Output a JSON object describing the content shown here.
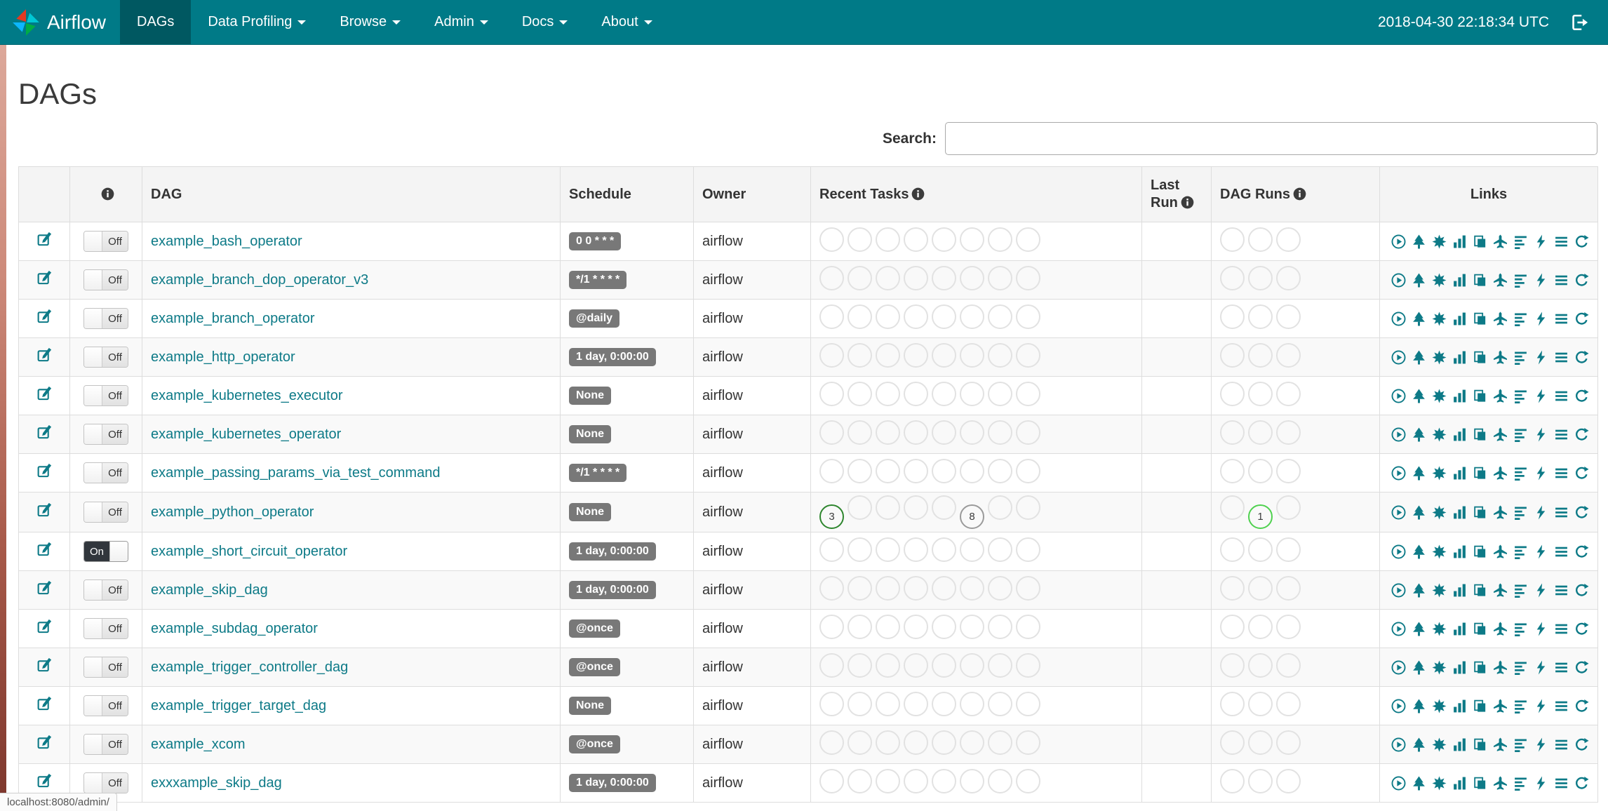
{
  "navbar": {
    "brand": "Airflow",
    "items": [
      {
        "label": "DAGs",
        "active": true,
        "dropdown": false
      },
      {
        "label": "Data Profiling",
        "active": false,
        "dropdown": true
      },
      {
        "label": "Browse",
        "active": false,
        "dropdown": true
      },
      {
        "label": "Admin",
        "active": false,
        "dropdown": true
      },
      {
        "label": "Docs",
        "active": false,
        "dropdown": true
      },
      {
        "label": "About",
        "active": false,
        "dropdown": true
      }
    ],
    "clock": "2018-04-30 22:18:34 UTC"
  },
  "page": {
    "title": "DAGs"
  },
  "search": {
    "label": "Search:",
    "value": ""
  },
  "table": {
    "headers": {
      "dag": "DAG",
      "schedule": "Schedule",
      "owner": "Owner",
      "recent_tasks": "Recent Tasks",
      "last_run": "Last Run",
      "dag_runs": "DAG Runs",
      "links": "Links"
    },
    "recent_task_slots": 8,
    "dag_run_slots": 3,
    "link_icons": [
      "trigger-dag",
      "tree-view",
      "graph-view",
      "task-duration",
      "task-tries",
      "landing-times",
      "gantt-view",
      "code-view",
      "logs",
      "refresh"
    ]
  },
  "colors": {
    "navbar": "#007A87",
    "link": "#0d7a87",
    "badge": "#787878",
    "success_ring": "#2e862e",
    "running_ring": "#4fd14f",
    "no_status_ring": "#9a9a9a"
  },
  "status_bar": {
    "text": "localhost:8080/admin/"
  },
  "dags": [
    {
      "name": "example_bash_operator",
      "toggle": "Off",
      "schedule": "0 0 * * *",
      "owner": "airflow",
      "recent_tasks": [],
      "dag_runs": []
    },
    {
      "name": "example_branch_dop_operator_v3",
      "toggle": "Off",
      "schedule": "*/1 * * * *",
      "owner": "airflow",
      "recent_tasks": [],
      "dag_runs": []
    },
    {
      "name": "example_branch_operator",
      "toggle": "Off",
      "schedule": "@daily",
      "owner": "airflow",
      "recent_tasks": [],
      "dag_runs": []
    },
    {
      "name": "example_http_operator",
      "toggle": "Off",
      "schedule": "1 day, 0:00:00",
      "owner": "airflow",
      "recent_tasks": [],
      "dag_runs": []
    },
    {
      "name": "example_kubernetes_executor",
      "toggle": "Off",
      "schedule": "None",
      "owner": "airflow",
      "recent_tasks": [],
      "dag_runs": []
    },
    {
      "name": "example_kubernetes_operator",
      "toggle": "Off",
      "schedule": "None",
      "owner": "airflow",
      "recent_tasks": [],
      "dag_runs": []
    },
    {
      "name": "example_passing_params_via_test_command",
      "toggle": "Off",
      "schedule": "*/1 * * * *",
      "owner": "airflow",
      "recent_tasks": [],
      "dag_runs": []
    },
    {
      "name": "example_python_operator",
      "toggle": "Off",
      "schedule": "None",
      "owner": "airflow",
      "recent_tasks": [
        {
          "slot": 0,
          "count": 3,
          "status": "success"
        },
        {
          "slot": 5,
          "count": 8,
          "status": "none"
        }
      ],
      "dag_runs": [
        {
          "slot": 1,
          "count": 1,
          "status": "running"
        }
      ]
    },
    {
      "name": "example_short_circuit_operator",
      "toggle": "On",
      "schedule": "1 day, 0:00:00",
      "owner": "airflow",
      "recent_tasks": [],
      "dag_runs": []
    },
    {
      "name": "example_skip_dag",
      "toggle": "Off",
      "schedule": "1 day, 0:00:00",
      "owner": "airflow",
      "recent_tasks": [],
      "dag_runs": []
    },
    {
      "name": "example_subdag_operator",
      "toggle": "Off",
      "schedule": "@once",
      "owner": "airflow",
      "recent_tasks": [],
      "dag_runs": []
    },
    {
      "name": "example_trigger_controller_dag",
      "toggle": "Off",
      "schedule": "@once",
      "owner": "airflow",
      "recent_tasks": [],
      "dag_runs": []
    },
    {
      "name": "example_trigger_target_dag",
      "toggle": "Off",
      "schedule": "None",
      "owner": "airflow",
      "recent_tasks": [],
      "dag_runs": []
    },
    {
      "name": "example_xcom",
      "toggle": "Off",
      "schedule": "@once",
      "owner": "airflow",
      "recent_tasks": [],
      "dag_runs": []
    },
    {
      "name": "exxxample_skip_dag",
      "toggle": "Off",
      "schedule": "1 day, 0:00:00",
      "owner": "airflow",
      "recent_tasks": [],
      "dag_runs": []
    }
  ]
}
